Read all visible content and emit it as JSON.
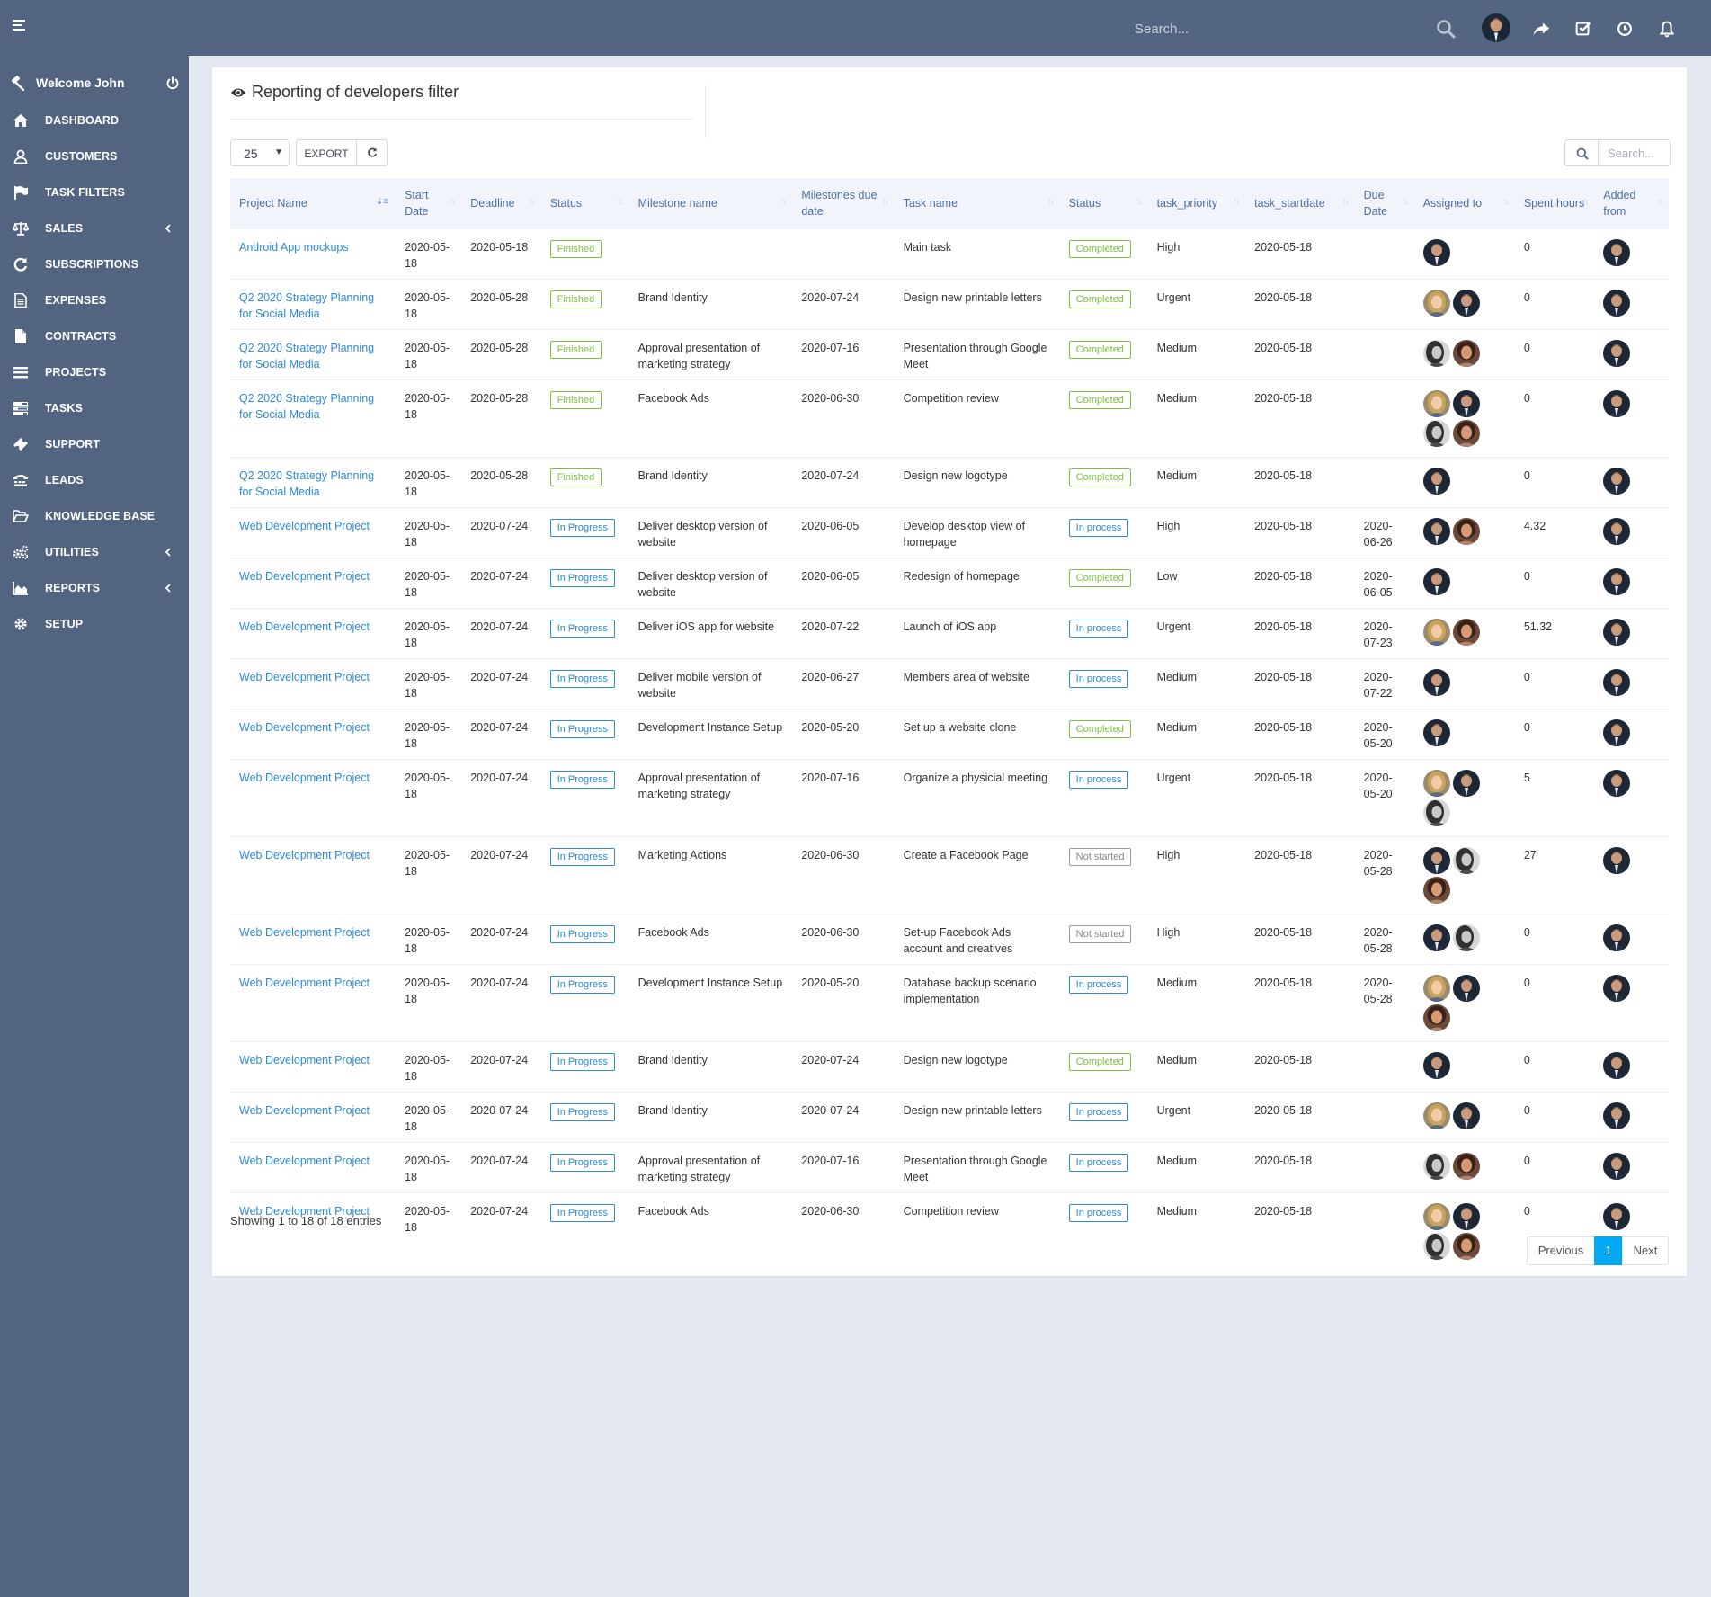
{
  "header": {
    "search_placeholder": "Search...",
    "icons": [
      "menu-icon",
      "search-icon",
      "share-icon",
      "check-square-icon",
      "clock-icon",
      "bell-icon"
    ]
  },
  "sidebar": {
    "welcome": "Welcome John",
    "items": [
      {
        "label": "DASHBOARD",
        "icon": "home-icon"
      },
      {
        "label": "CUSTOMERS",
        "icon": "user-icon"
      },
      {
        "label": "TASK FILTERS",
        "icon": "flag-icon"
      },
      {
        "label": "SALES",
        "icon": "balance-scale-icon",
        "has_submenu": true
      },
      {
        "label": "SUBSCRIPTIONS",
        "icon": "refresh-icon"
      },
      {
        "label": "EXPENSES",
        "icon": "file-text-icon"
      },
      {
        "label": "CONTRACTS",
        "icon": "file-icon"
      },
      {
        "label": "PROJECTS",
        "icon": "bars-icon"
      },
      {
        "label": "TASKS",
        "icon": "tasks-icon"
      },
      {
        "label": "SUPPORT",
        "icon": "ticket-icon"
      },
      {
        "label": "LEADS",
        "icon": "tty-icon"
      },
      {
        "label": "KNOWLEDGE BASE",
        "icon": "folder-open-icon"
      },
      {
        "label": "UTILITIES",
        "icon": "cogs-icon",
        "has_submenu": true
      },
      {
        "label": "REPORTS",
        "icon": "area-chart-icon",
        "has_submenu": true
      },
      {
        "label": "SETUP",
        "icon": "cog-icon"
      }
    ]
  },
  "panel": {
    "title": "Reporting of developers filter",
    "page_length": "25",
    "export_label": "EXPORT",
    "search_placeholder": "Search..."
  },
  "table": {
    "columns": [
      "Project Name",
      "Start Date",
      "Deadline",
      "Status",
      "Milestone name",
      "Milestones due date",
      "Task name",
      "Status",
      "task_priority",
      "task_startdate",
      "Due Date",
      "Assigned to",
      "Spent hours",
      "Added from"
    ],
    "rows": [
      {
        "project": "Android App mockups",
        "start": "2020-05-18",
        "deadline": "2020-05-18",
        "pstatus": "Finished",
        "milestone": "",
        "mdue": "",
        "task": "Main task",
        "tstatus": "Completed",
        "priority": "High",
        "tstart": "2020-05-18",
        "due": "",
        "assigned": [
          "man"
        ],
        "hours": "0"
      },
      {
        "project": "Q2 2020 Strategy Planning for Social Media",
        "start": "2020-05-18",
        "deadline": "2020-05-28",
        "pstatus": "Finished",
        "milestone": "Brand Identity",
        "mdue": "2020-07-24",
        "task": "Design new printable letters",
        "tstatus": "Completed",
        "priority": "Urgent",
        "tstart": "2020-05-18",
        "due": "",
        "assigned": [
          "blonde",
          "man"
        ],
        "hours": "0"
      },
      {
        "project": "Q2 2020 Strategy Planning for Social Media",
        "start": "2020-05-18",
        "deadline": "2020-05-28",
        "pstatus": "Finished",
        "milestone": "Approval presentation of marketing strategy",
        "mdue": "2020-07-16",
        "task": "Presentation through Google Meet",
        "tstatus": "Completed",
        "priority": "Medium",
        "tstart": "2020-05-18",
        "due": "",
        "assigned": [
          "bw",
          "curly"
        ],
        "hours": "0"
      },
      {
        "project": "Q2 2020 Strategy Planning for Social Media",
        "start": "2020-05-18",
        "deadline": "2020-05-28",
        "pstatus": "Finished",
        "milestone": "Facebook Ads",
        "mdue": "2020-06-30",
        "task": "Competition review",
        "tstatus": "Completed",
        "priority": "Medium",
        "tstart": "2020-05-18",
        "due": "",
        "assigned": [
          "blonde",
          "man",
          "bw",
          "curly"
        ],
        "hours": "0"
      },
      {
        "project": "Q2 2020 Strategy Planning for Social Media",
        "start": "2020-05-18",
        "deadline": "2020-05-28",
        "pstatus": "Finished",
        "milestone": "Brand Identity",
        "mdue": "2020-07-24",
        "task": "Design new logotype",
        "tstatus": "Completed",
        "priority": "Medium",
        "tstart": "2020-05-18",
        "due": "",
        "assigned": [
          "man"
        ],
        "hours": "0"
      },
      {
        "project": "Web Development Project",
        "start": "2020-05-18",
        "deadline": "2020-07-24",
        "pstatus": "In Progress",
        "milestone": "Deliver desktop version of website",
        "mdue": "2020-06-05",
        "task": "Develop desktop view of homepage",
        "tstatus": "In process",
        "priority": "High",
        "tstart": "2020-05-18",
        "due": "2020-06-26",
        "assigned": [
          "man",
          "curly"
        ],
        "hours": "4.32"
      },
      {
        "project": "Web Development Project",
        "start": "2020-05-18",
        "deadline": "2020-07-24",
        "pstatus": "In Progress",
        "milestone": "Deliver desktop version of website",
        "mdue": "2020-06-05",
        "task": "Redesign of homepage",
        "tstatus": "Completed",
        "priority": "Low",
        "tstart": "2020-05-18",
        "due": "2020-06-05",
        "assigned": [
          "man"
        ],
        "hours": "0"
      },
      {
        "project": "Web Development Project",
        "start": "2020-05-18",
        "deadline": "2020-07-24",
        "pstatus": "In Progress",
        "milestone": "Deliver iOS app for website",
        "mdue": "2020-07-22",
        "task": "Launch of iOS app",
        "tstatus": "In process",
        "priority": "Urgent",
        "tstart": "2020-05-18",
        "due": "2020-07-23",
        "assigned": [
          "blonde",
          "curly"
        ],
        "hours": "51.32"
      },
      {
        "project": "Web Development Project",
        "start": "2020-05-18",
        "deadline": "2020-07-24",
        "pstatus": "In Progress",
        "milestone": "Deliver mobile version of website",
        "mdue": "2020-06-27",
        "task": "Members area of website",
        "tstatus": "In process",
        "priority": "Medium",
        "tstart": "2020-05-18",
        "due": "2020-07-22",
        "assigned": [
          "man"
        ],
        "hours": "0"
      },
      {
        "project": "Web Development Project",
        "start": "2020-05-18",
        "deadline": "2020-07-24",
        "pstatus": "In Progress",
        "milestone": "Development Instance Setup",
        "mdue": "2020-05-20",
        "task": "Set up a website clone",
        "tstatus": "Completed",
        "priority": "Medium",
        "tstart": "2020-05-18",
        "due": "2020-05-20",
        "assigned": [
          "man"
        ],
        "hours": "0"
      },
      {
        "project": "Web Development Project",
        "start": "2020-05-18",
        "deadline": "2020-07-24",
        "pstatus": "In Progress",
        "milestone": "Approval presentation of marketing strategy",
        "mdue": "2020-07-16",
        "task": "Organize a physicial meeting",
        "tstatus": "In process",
        "priority": "Urgent",
        "tstart": "2020-05-18",
        "due": "2020-05-20",
        "assigned": [
          "blonde",
          "man",
          "bw"
        ],
        "hours": "5"
      },
      {
        "project": "Web Development Project",
        "start": "2020-05-18",
        "deadline": "2020-07-24",
        "pstatus": "In Progress",
        "milestone": "Marketing Actions",
        "mdue": "2020-06-30",
        "task": "Create a Facebook Page",
        "tstatus": "Not started",
        "priority": "High",
        "tstart": "2020-05-18",
        "due": "2020-05-28",
        "assigned": [
          "man",
          "bw",
          "curly"
        ],
        "hours": "27"
      },
      {
        "project": "Web Development Project",
        "start": "2020-05-18",
        "deadline": "2020-07-24",
        "pstatus": "In Progress",
        "milestone": "Facebook Ads",
        "mdue": "2020-06-30",
        "task": "Set-up Facebook Ads account and creatives",
        "tstatus": "Not started",
        "priority": "High",
        "tstart": "2020-05-18",
        "due": "2020-05-28",
        "assigned": [
          "man",
          "bw"
        ],
        "hours": "0"
      },
      {
        "project": "Web Development Project",
        "start": "2020-05-18",
        "deadline": "2020-07-24",
        "pstatus": "In Progress",
        "milestone": "Development Instance Setup",
        "mdue": "2020-05-20",
        "task": "Database backup scenario implementation",
        "tstatus": "In process",
        "priority": "Medium",
        "tstart": "2020-05-18",
        "due": "2020-05-28",
        "assigned": [
          "blonde",
          "man",
          "curly"
        ],
        "hours": "0"
      },
      {
        "project": "Web Development Project",
        "start": "2020-05-18",
        "deadline": "2020-07-24",
        "pstatus": "In Progress",
        "milestone": "Brand Identity",
        "mdue": "2020-07-24",
        "task": "Design new logotype",
        "tstatus": "Completed",
        "priority": "Medium",
        "tstart": "2020-05-18",
        "due": "",
        "assigned": [
          "man"
        ],
        "hours": "0"
      },
      {
        "project": "Web Development Project",
        "start": "2020-05-18",
        "deadline": "2020-07-24",
        "pstatus": "In Progress",
        "milestone": "Brand Identity",
        "mdue": "2020-07-24",
        "task": "Design new printable letters",
        "tstatus": "In process",
        "priority": "Urgent",
        "tstart": "2020-05-18",
        "due": "",
        "assigned": [
          "blonde",
          "man"
        ],
        "hours": "0"
      },
      {
        "project": "Web Development Project",
        "start": "2020-05-18",
        "deadline": "2020-07-24",
        "pstatus": "In Progress",
        "milestone": "Approval presentation of marketing strategy",
        "mdue": "2020-07-16",
        "task": "Presentation through Google Meet",
        "tstatus": "In process",
        "priority": "Medium",
        "tstart": "2020-05-18",
        "due": "",
        "assigned": [
          "bw",
          "curly"
        ],
        "hours": "0"
      },
      {
        "project": "Web Development Project",
        "start": "2020-05-18",
        "deadline": "2020-07-24",
        "pstatus": "In Progress",
        "milestone": "Facebook Ads",
        "mdue": "2020-06-30",
        "task": "Competition review",
        "tstatus": "In process",
        "priority": "Medium",
        "tstart": "2020-05-18",
        "due": "",
        "assigned": [
          "blonde",
          "man",
          "bw",
          "curly"
        ],
        "hours": "0"
      }
    ]
  },
  "footer": {
    "info": "Showing 1 to 18 of 18 entries",
    "previous": "Previous",
    "current_page": "1",
    "next": "Next"
  },
  "colors": {
    "header_bg": "#546581",
    "sidebar_bg": "#536480",
    "link": "#2e8ad8",
    "finished_green": "#7cc144",
    "urgent_red": "#f0373c",
    "high_orange": "#f57c2e",
    "page_active": "#03a9f4"
  }
}
